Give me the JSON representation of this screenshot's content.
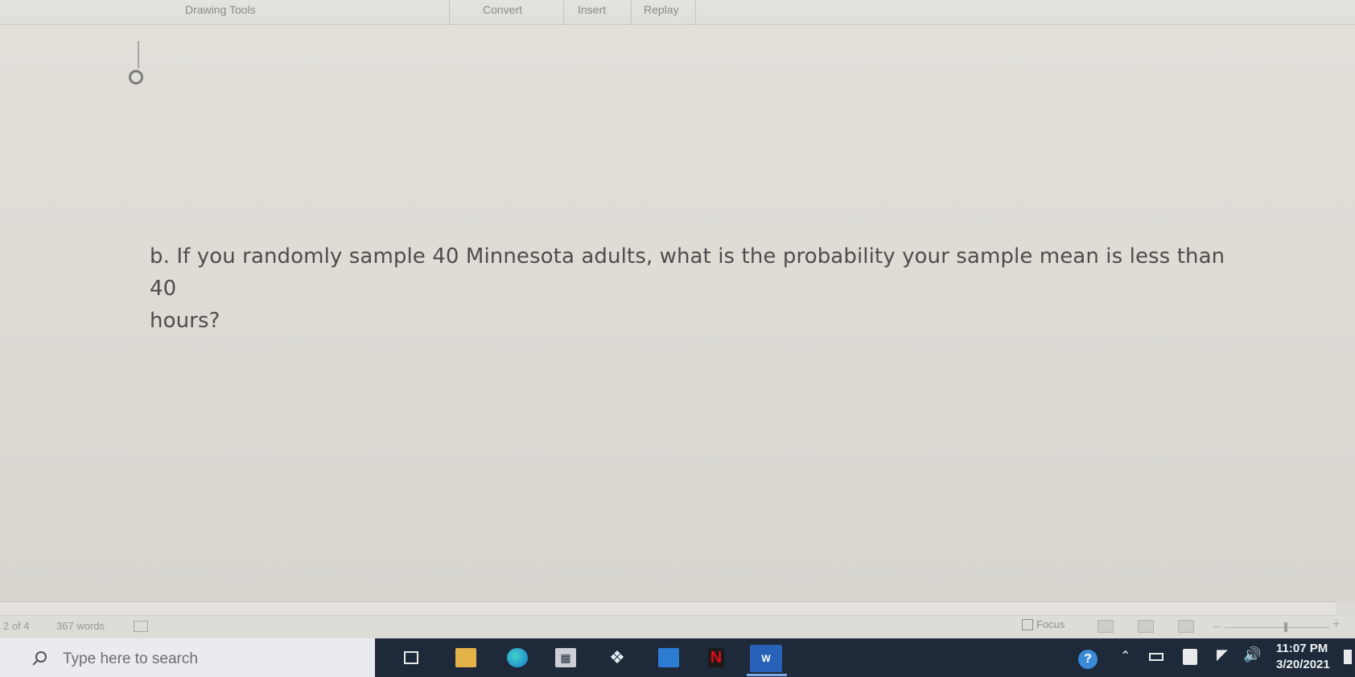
{
  "ribbon": {
    "tabs": [
      "Drawing Tools",
      "Convert",
      "Insert",
      "Replay"
    ]
  },
  "document": {
    "question_line1": "b. If you randomly sample 40 Minnesota adults, what is the probability your sample mean is less than 40",
    "question_line2": "hours?"
  },
  "status_bar": {
    "page": "2 of 4",
    "words": "367 words",
    "focus_label": "Focus",
    "zoom_minus": "–",
    "zoom_plus": "+"
  },
  "taskbar": {
    "search_placeholder": "Type here to search",
    "apps": [
      "task-view",
      "file-explorer",
      "edge",
      "store",
      "dropbox",
      "mail",
      "netflix",
      "word"
    ],
    "word_label": "W",
    "netflix_label": "N",
    "help_label": "?",
    "time": "11:07 PM",
    "date": "3/20/2021"
  },
  "colors": {
    "document_bg": "#dedcd5",
    "text": "#4e4d4b",
    "taskbar": "#1e2a3a"
  }
}
